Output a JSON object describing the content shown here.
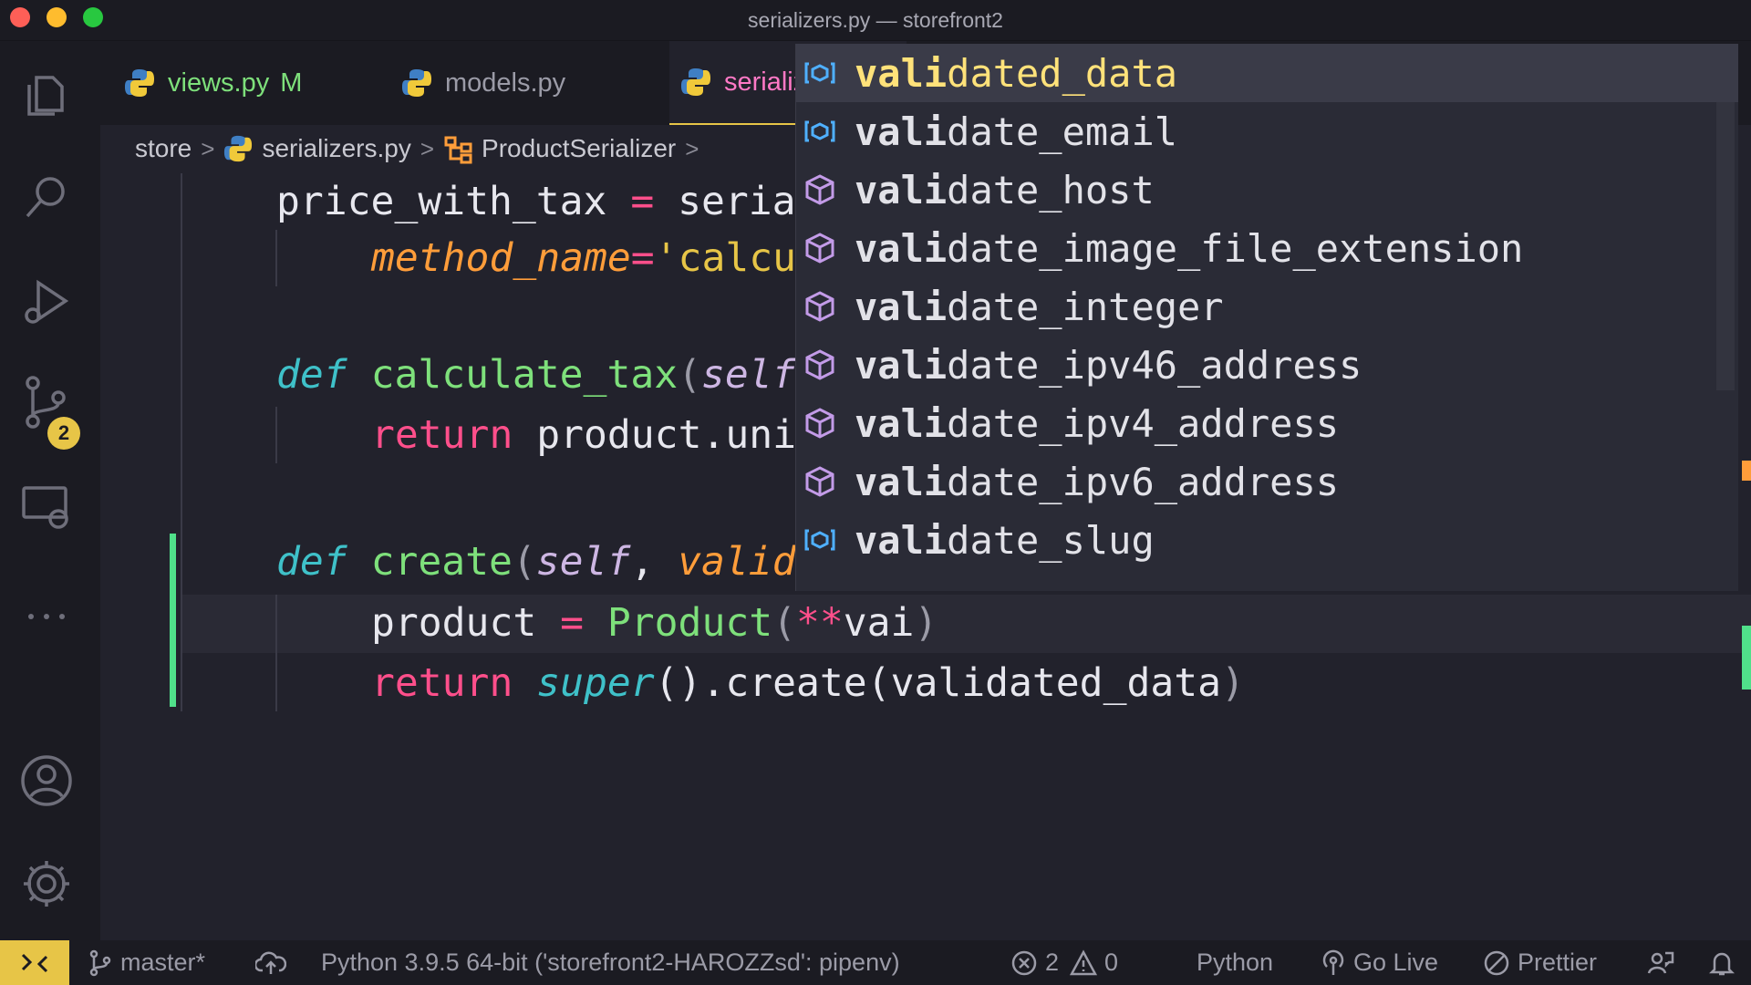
{
  "window": {
    "title": "serializers.py — storefront2"
  },
  "activity_bar": {
    "source_control_badge": "2"
  },
  "tabs": [
    {
      "label": "views.py",
      "modified": "M"
    },
    {
      "label": "models.py"
    },
    {
      "label": "serializers.py"
    }
  ],
  "breadcrumb": {
    "folder": "store",
    "file": "serializers.py",
    "class": "ProductSerializer"
  },
  "code": {
    "line1": {
      "name": "price_with_tax",
      "eq": " = ",
      "call": "seria"
    },
    "line2": {
      "kwarg": "method_name",
      "eq": "=",
      "str": "'calcu"
    },
    "line4": {
      "kw": "def",
      "fn": "calculate_tax",
      "open": "(",
      "param": "self"
    },
    "line5": {
      "kw": "return",
      "expr": "product.uni"
    },
    "line7": {
      "kw": "def",
      "fn": "create",
      "open": "(",
      "param": "self",
      "comma": ", ",
      "param2": "valid"
    },
    "line8": {
      "var": "product",
      "eq": " = ",
      "cls": "Product",
      "open": "(",
      "op": "**",
      "typed": "vai",
      "close": ")"
    },
    "line9": {
      "kw": "return",
      "sup": "super",
      "call": "().create(",
      "arg": "validated_data",
      "close": ")"
    }
  },
  "suggestions": [
    {
      "match": "vali",
      "rest": "dated_data",
      "icon": "variable-icon"
    },
    {
      "match": "vali",
      "rest": "date_email",
      "icon": "variable-icon"
    },
    {
      "match": "vali",
      "rest": "date_host",
      "icon": "module-icon"
    },
    {
      "match": "vali",
      "rest": "date_image_file_extension",
      "icon": "module-icon"
    },
    {
      "match": "vali",
      "rest": "date_integer",
      "icon": "module-icon"
    },
    {
      "match": "vali",
      "rest": "date_ipv46_address",
      "icon": "module-icon"
    },
    {
      "match": "vali",
      "rest": "date_ipv4_address",
      "icon": "module-icon"
    },
    {
      "match": "vali",
      "rest": "date_ipv6_address",
      "icon": "module-icon"
    },
    {
      "match": "vali",
      "rest": "date_slug",
      "icon": "variable-icon"
    }
  ],
  "status_bar": {
    "branch": "master*",
    "interpreter": "Python 3.9.5 64-bit ('storefront2-HAROZZsd': pipenv)",
    "errors": "2",
    "warnings": "0",
    "language": "Python",
    "go_live": "Go Live",
    "prettier": "Prettier"
  },
  "colors": {
    "accent_yellow": "#e7c547",
    "keyword_cyan": "#3fc1c9",
    "keyword_pink": "#ff4f8b",
    "function_green": "#7ee07b",
    "param_orange": "#ff9d3a"
  }
}
